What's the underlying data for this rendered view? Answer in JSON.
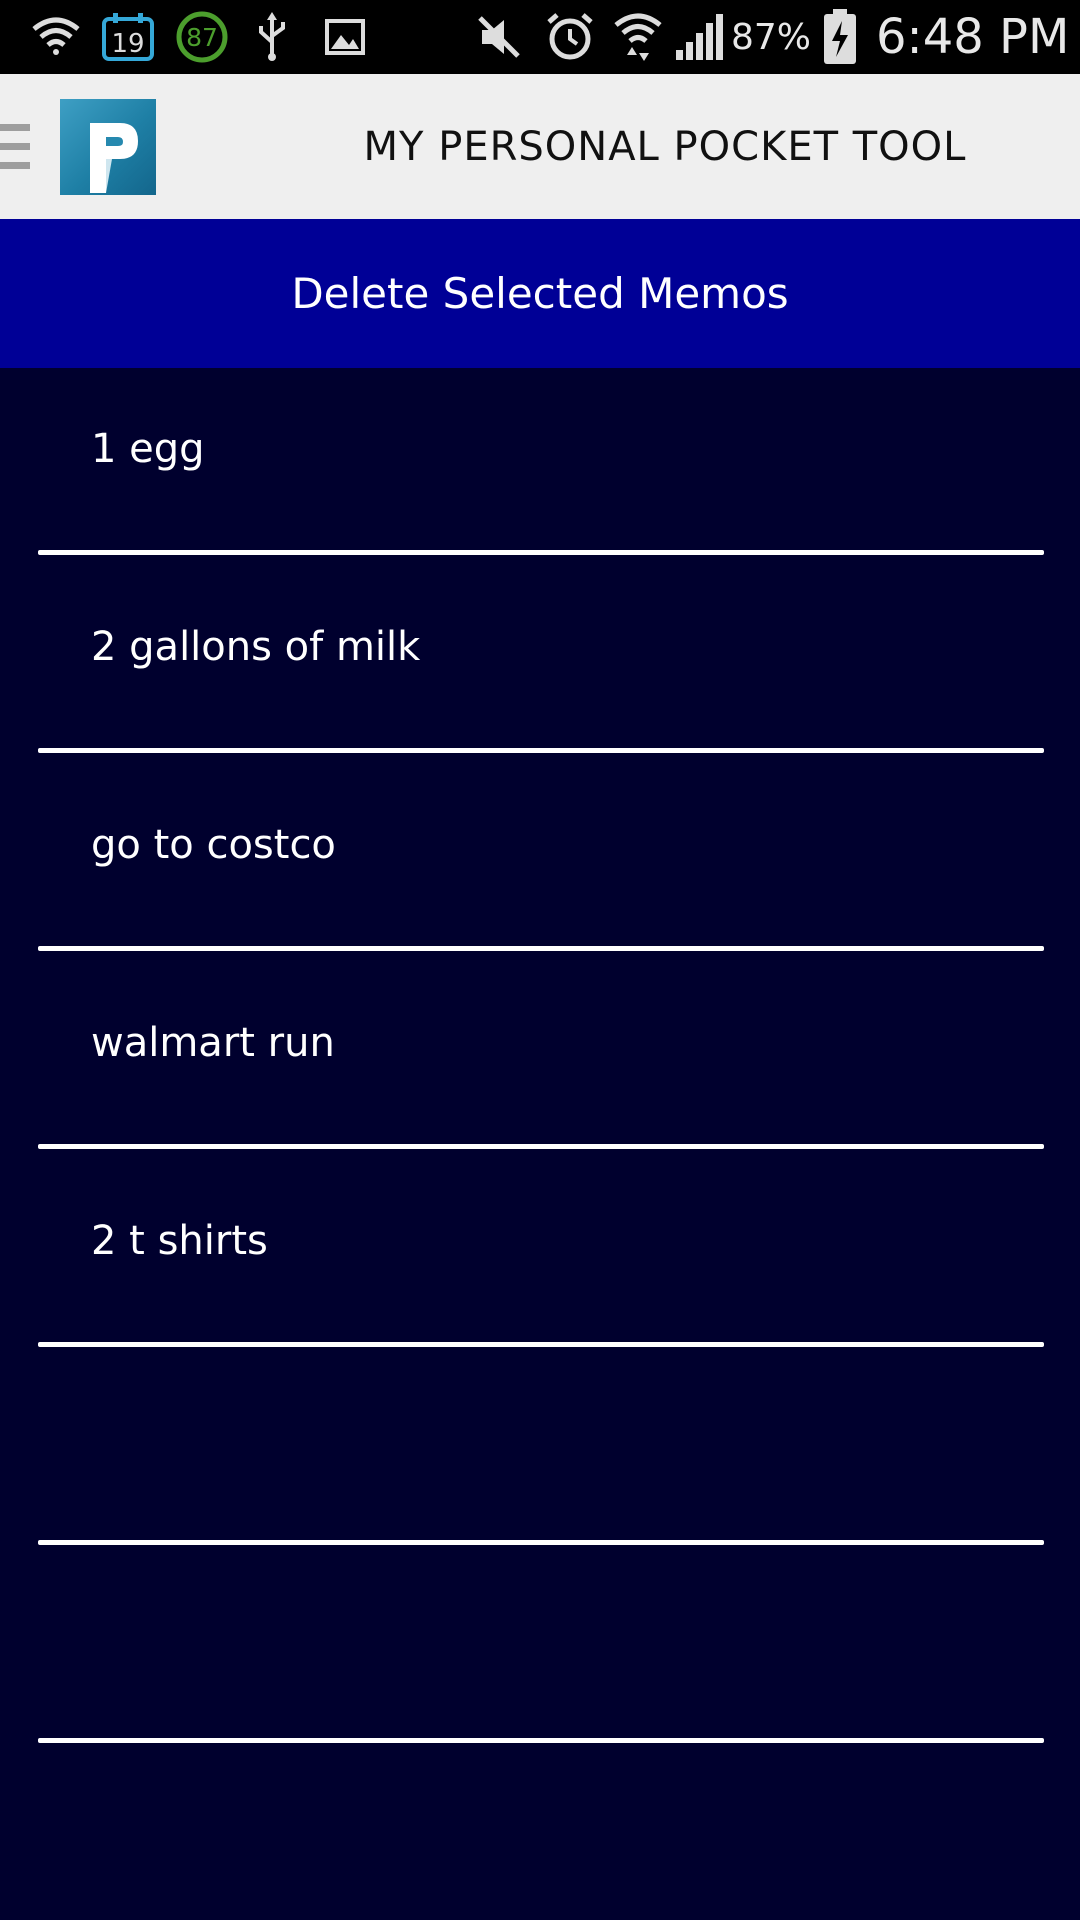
{
  "status_bar": {
    "calendar_day": "19",
    "circle_badge": "87",
    "battery_percent": "87%",
    "time": "6:48 PM",
    "icons": [
      "wifi-question-icon",
      "calendar-icon",
      "circle-badge-icon",
      "usb-icon",
      "image-icon",
      "mute-icon",
      "alarm-icon",
      "wifi-icon",
      "signal-icon",
      "battery-charging-icon"
    ]
  },
  "app_bar": {
    "title": "MY PERSONAL POCKET TOOL",
    "logo_letter": "P"
  },
  "actions": {
    "delete_label": "Delete Selected Memos"
  },
  "memos": [
    {
      "text": "1 egg"
    },
    {
      "text": "2 gallons of milk"
    },
    {
      "text": "go to costco"
    },
    {
      "text": "walmart run"
    },
    {
      "text": "2 t shirts"
    },
    {
      "text": ""
    },
    {
      "text": ""
    }
  ],
  "colors": {
    "background": "#00002e",
    "delete_bar": "#000096",
    "app_bar": "#efefef",
    "logo": "#1e7fa5"
  }
}
